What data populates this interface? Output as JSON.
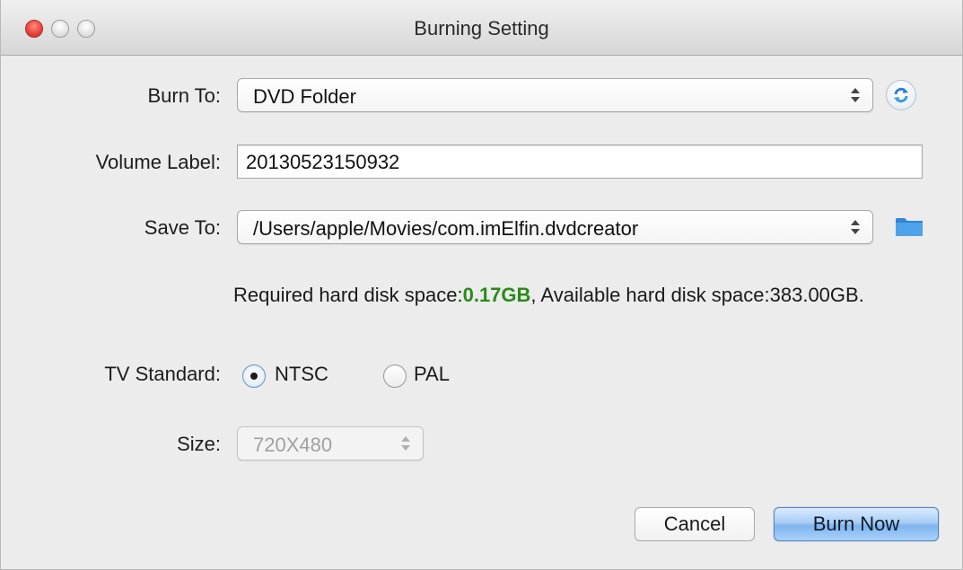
{
  "window": {
    "title": "Burning Setting"
  },
  "form": {
    "burn_to": {
      "label": "Burn To:",
      "value": "DVD Folder"
    },
    "volume_label": {
      "label": "Volume Label:",
      "value": "20130523150932"
    },
    "save_to": {
      "label": "Save To:",
      "value": "/Users/apple/Movies/com.imElfin.dvdcreator"
    },
    "disk_info": {
      "required_prefix": "Required hard disk space:",
      "required_value": "0.17GB",
      "available_text": ", Available hard disk space:383.00GB."
    },
    "tv_standard": {
      "label": "TV Standard:",
      "options": [
        "NTSC",
        "PAL"
      ],
      "selected": "NTSC"
    },
    "size": {
      "label": "Size:",
      "value": "720X480",
      "enabled": false
    }
  },
  "buttons": {
    "cancel": "Cancel",
    "burn_now": "Burn Now"
  },
  "colors": {
    "accent_green": "#2a8a1a",
    "close_red": "#e9453c",
    "primary_blue": "#7fb4ee"
  },
  "icons": {
    "refresh": "refresh-icon",
    "folder": "folder-icon"
  }
}
